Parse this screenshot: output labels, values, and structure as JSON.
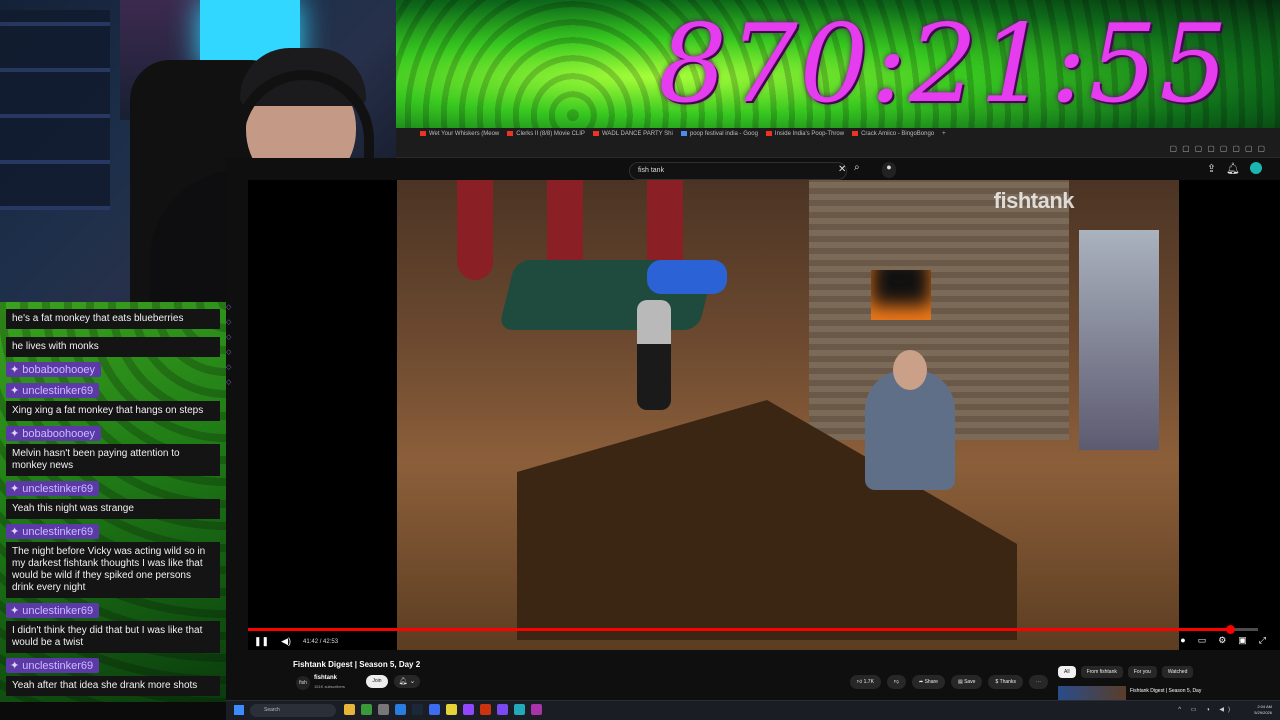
{
  "timer": {
    "value": "870:21:55"
  },
  "chat": {
    "messages": [
      {
        "user": "",
        "text": "he's a fat monkey that eats blueberries"
      },
      {
        "user": "",
        "text": "he lives with monks"
      },
      {
        "user": "bobaboohooey",
        "text": ""
      },
      {
        "user": "unclestinker69",
        "text": "Xing xing a fat monkey that hangs on steps"
      },
      {
        "user": "bobaboohooey",
        "text": "Melvin hasn't been paying attention to monkey news"
      },
      {
        "user": "unclestinker69",
        "text": "Yeah this night was strange"
      },
      {
        "user": "unclestinker69",
        "text": "The night before Vicky was acting wild so in my darkest fishtank thoughts I was like that would be wild if they spiked one persons drink every night"
      },
      {
        "user": "unclestinker69",
        "text": "I didn't think they did that but I was like that would be a twist"
      },
      {
        "user": "unclestinker69",
        "text": "Yeah after that idea she drank more shots"
      }
    ]
  },
  "browser": {
    "tabs": [
      "Wet Your Whiskers (Meow",
      "Clerks II (8/8) Movie CLIP",
      "WADL DANCE PARTY Shi",
      "poop festival india - Goog",
      "Inside India's Poop-Throw",
      "Crack Amiico - BingoBongo"
    ]
  },
  "youtube": {
    "search_value": "fish tank",
    "video": {
      "watermark": "fishtank",
      "current_time": "41:42",
      "duration": "42:53",
      "time_display": "41:42 / 42:53",
      "progress": 0.972
    },
    "title": "Fishtank Digest | Season 5, Day 2",
    "channel": {
      "logo_text": "fish",
      "name": "fishtank",
      "subscribers": "151K subscribers",
      "join_label": "Join"
    },
    "actions": {
      "likes": "1.7K",
      "share": "Share",
      "save": "Save",
      "thanks": "Thanks"
    },
    "chips": [
      "All",
      "From fishtank",
      "For you",
      "Watched"
    ],
    "recommendation": {
      "title": "Fishtank Digest | Season 5, Day"
    }
  },
  "taskbar": {
    "search_placeholder": "Search",
    "time": "2:04 AM",
    "date": "5/29/2026"
  },
  "colors": {
    "timer": "#e63cf0",
    "username_badge": "#5b3aa8",
    "progress": "#ff0000",
    "chat_bg": "#3aa31e"
  }
}
